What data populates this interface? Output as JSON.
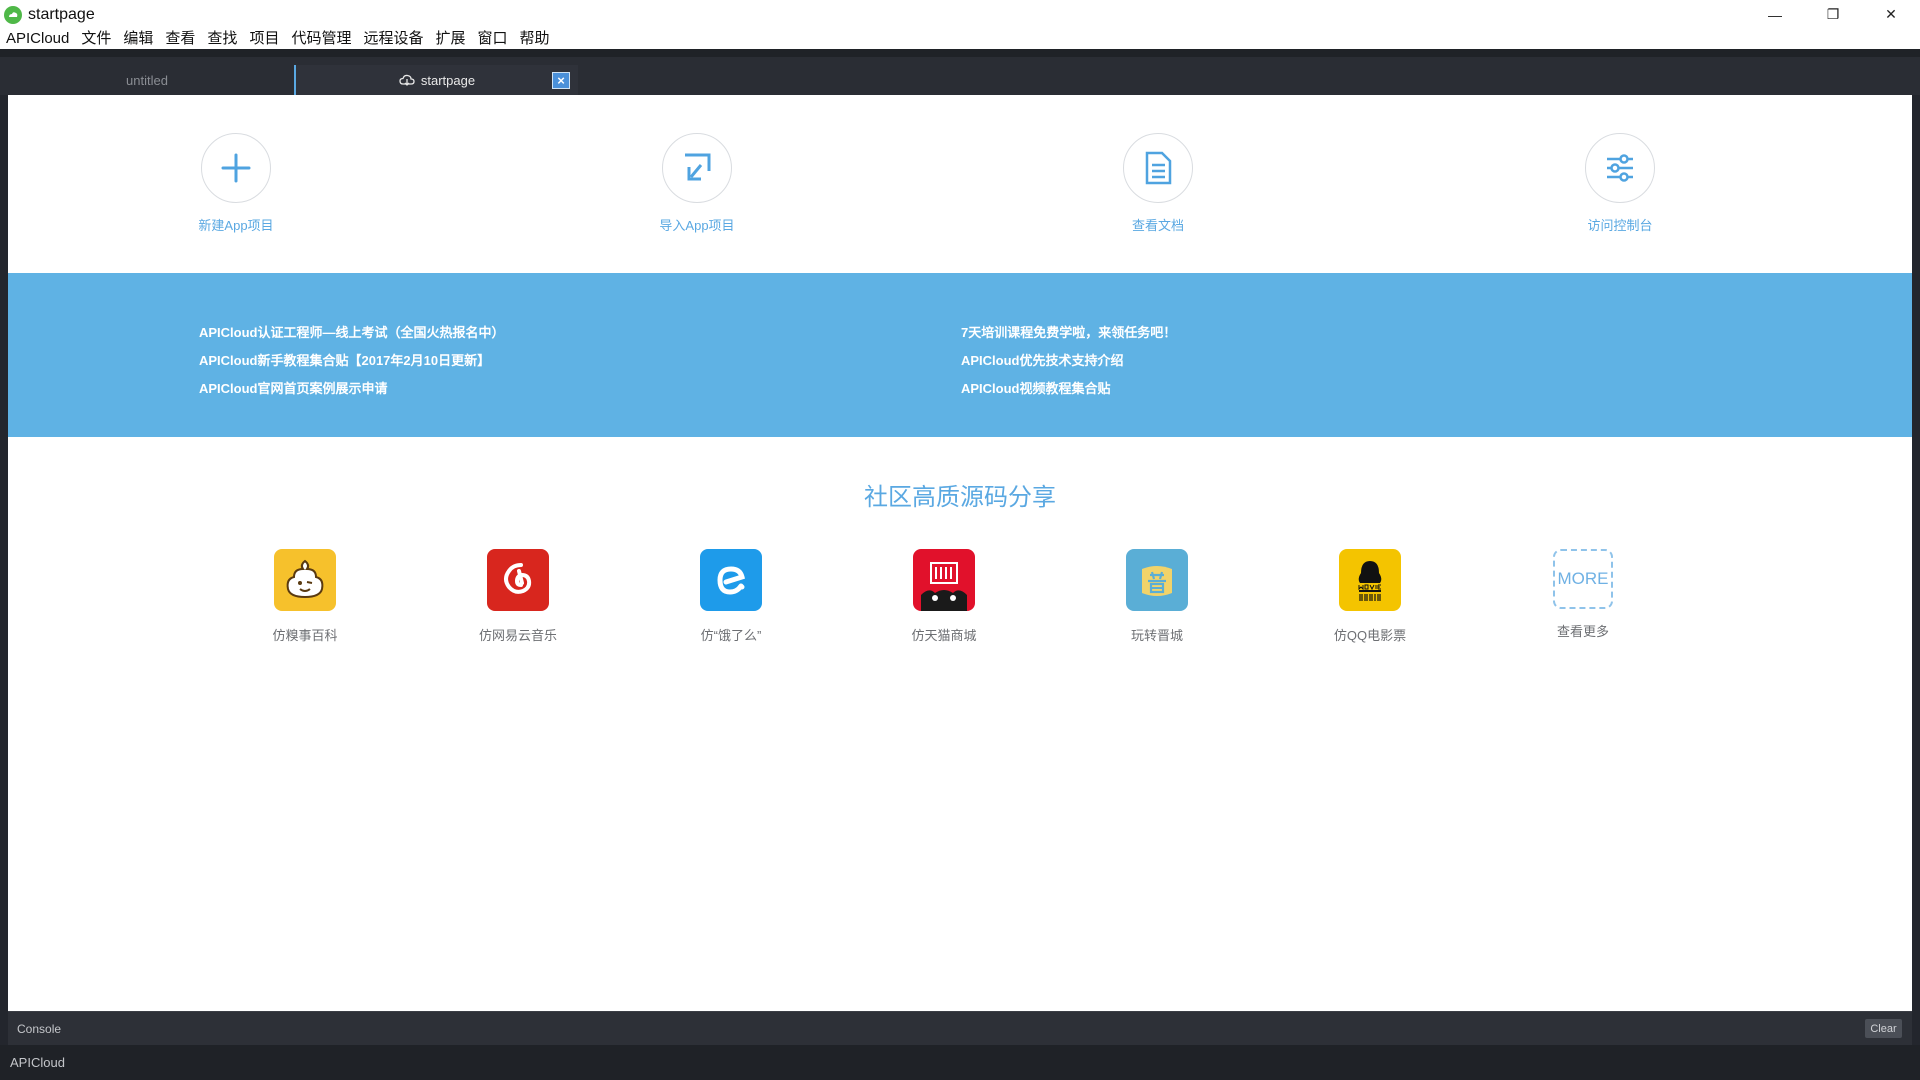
{
  "window": {
    "title": "startpage",
    "minimize": "—",
    "maximize": "❐",
    "close": "✕"
  },
  "menu": [
    "APICloud",
    "文件",
    "编辑",
    "查看",
    "查找",
    "项目",
    "代码管理",
    "远程设备",
    "扩展",
    "窗口",
    "帮助"
  ],
  "tabs": {
    "untitled": "untitled",
    "startpage": "startpage",
    "close": "×"
  },
  "quick_actions": [
    {
      "label": "新建App项目",
      "icon": "plus-icon"
    },
    {
      "label": "导入App项目",
      "icon": "import-icon"
    },
    {
      "label": "查看文档",
      "icon": "document-icon"
    },
    {
      "label": "访问控制台",
      "icon": "sliders-icon"
    }
  ],
  "banner": {
    "left": [
      "APICloud认证工程师—线上考试（全国火热报名中）",
      "APICloud新手教程集合贴【2017年2月10日更新】",
      "APICloud官网首页案例展示申请"
    ],
    "right": [
      "7天培训课程免费学啦，来领任务吧！",
      "APICloud优先技术支持介绍",
      "APICloud视频教程集合贴"
    ]
  },
  "section_title": "社区高质源码分享",
  "apps": [
    {
      "name": "仿糗事百科",
      "icon": "qiushi-icon",
      "color": "#f6c12c"
    },
    {
      "name": "仿网易云音乐",
      "icon": "netease-music-icon",
      "color": "#d8261e"
    },
    {
      "name": "仿“饿了么”",
      "icon": "eleme-icon",
      "color": "#1e9bea"
    },
    {
      "name": "仿天猫商城",
      "icon": "tmall-icon",
      "color": "#e1112b"
    },
    {
      "name": "玩转晋城",
      "icon": "jincheng-icon",
      "color": "#5aaed6"
    },
    {
      "name": "仿QQ电影票",
      "icon": "qq-movie-icon",
      "color": "#f4c400"
    },
    {
      "name": "查看更多",
      "icon": "more-icon",
      "tile_text": "MORE"
    }
  ],
  "console": {
    "label": "Console",
    "clear": "Clear"
  },
  "status": {
    "text": "APICloud"
  },
  "colors": {
    "accent": "#5aa8e2",
    "banner": "#5fb2e4",
    "chrome": "#23262d"
  }
}
